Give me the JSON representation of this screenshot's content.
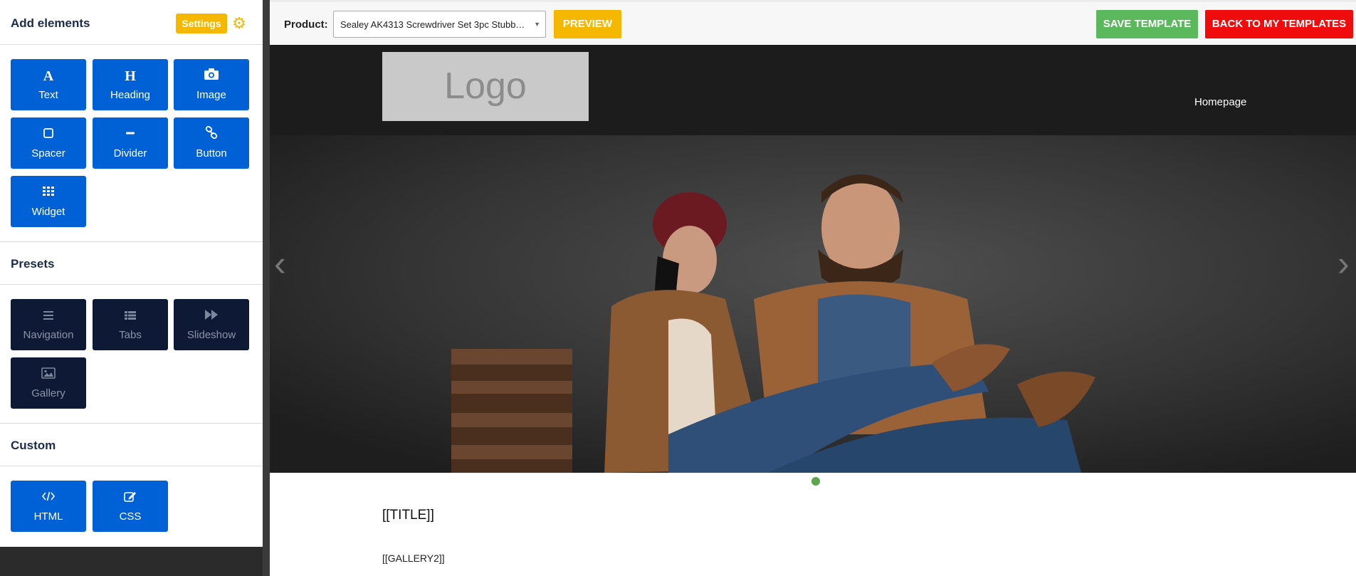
{
  "sidebar": {
    "add_elements_title": "Add elements",
    "settings_label": "Settings",
    "elements": [
      {
        "label": "Text",
        "icon": "A"
      },
      {
        "label": "Heading",
        "icon": "H"
      },
      {
        "label": "Image",
        "icon": "camera-icon"
      },
      {
        "label": "Spacer",
        "icon": "square-icon"
      },
      {
        "label": "Divider",
        "icon": "minus-icon"
      },
      {
        "label": "Button",
        "icon": "link-icon"
      },
      {
        "label": "Widget",
        "icon": "grid-icon"
      }
    ],
    "presets_title": "Presets",
    "presets": [
      {
        "label": "Navigation",
        "icon": "bars-icon"
      },
      {
        "label": "Tabs",
        "icon": "list-icon"
      },
      {
        "label": "Slideshow",
        "icon": "fast-forward-icon"
      },
      {
        "label": "Gallery",
        "icon": "picture-icon"
      }
    ],
    "custom_title": "Custom",
    "custom": [
      {
        "label": "HTML",
        "icon": "code-icon"
      },
      {
        "label": "CSS",
        "icon": "edit-icon"
      }
    ]
  },
  "topbar": {
    "product_label": "Product:",
    "product_value": "Sealey AK4313 Screwdriver Set 3pc Stubb…",
    "preview_label": "PREVIEW",
    "save_label": "SAVE TEMPLATE",
    "back_label": "BACK TO MY TEMPLATES"
  },
  "canvas": {
    "logo_text": "Logo",
    "nav_homepage": "Homepage",
    "title_placeholder": "[[TITLE]]",
    "gallery_placeholder": "[[GALLERY2]]"
  },
  "colors": {
    "accent_blue": "#0061d6",
    "preset_dark": "#0e1a35",
    "yellow": "#f5b700",
    "green": "#5cb85c",
    "red": "#f00c0c"
  }
}
